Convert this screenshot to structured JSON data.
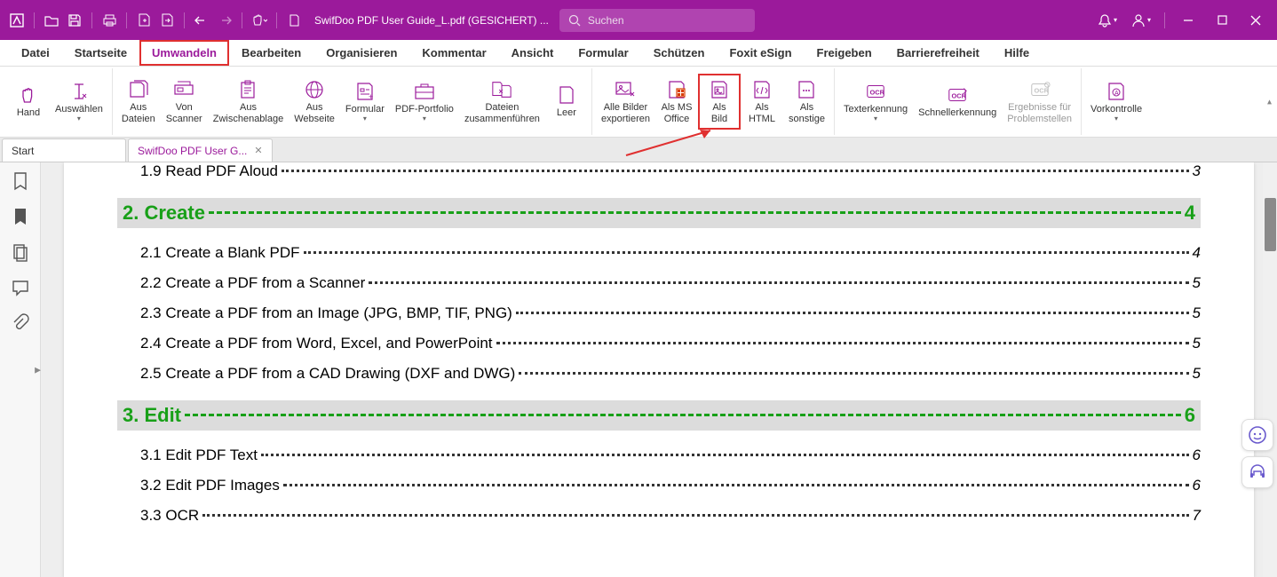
{
  "titlebar": {
    "filename": "SwifDoo PDF User Guide_L.pdf (GESICHERT) ...",
    "search_placeholder": "Suchen"
  },
  "menu": {
    "items": [
      "Datei",
      "Startseite",
      "Umwandeln",
      "Bearbeiten",
      "Organisieren",
      "Kommentar",
      "Ansicht",
      "Formular",
      "Schützen",
      "Foxit eSign",
      "Freigeben",
      "Barrierefreiheit",
      "Hilfe"
    ],
    "active_index": 2
  },
  "ribbon": {
    "hand": "Hand",
    "select": "Auswählen",
    "from_files": "Aus\nDateien",
    "from_scanner": "Von\nScanner",
    "from_clipboard": "Aus\nZwischenablage",
    "from_website": "Aus\nWebseite",
    "form": "Formular",
    "portfolio": "PDF-Portfolio",
    "merge": "Dateien\nzusammenführen",
    "blank": "Leer",
    "export_images": "Alle Bilder\nexportieren",
    "as_msoffice": "Als MS\nOffice",
    "as_image": "Als\nBild",
    "as_html": "Als\nHTML",
    "as_other": "Als\nsonstige",
    "ocr": "Texterkennung",
    "quick_ocr": "Schnellerkennung",
    "ocr_results": "Ergebnisse für\nProblemstellen",
    "preflight": "Vorkontrolle"
  },
  "tabs": {
    "start": "Start",
    "doc": "SwifDoo PDF User G..."
  },
  "toc": [
    {
      "type": "sub",
      "title": "1.9 Read PDF Aloud",
      "page": "3"
    },
    {
      "type": "section",
      "title": "2. Create",
      "page": "4"
    },
    {
      "type": "sub",
      "title": "2.1 Create a Blank PDF",
      "page": "4"
    },
    {
      "type": "sub",
      "title": "2.2 Create a PDF from a Scanner",
      "page": "5"
    },
    {
      "type": "sub",
      "title": "2.3 Create a PDF from an Image (JPG, BMP, TIF, PNG)",
      "page": "5"
    },
    {
      "type": "sub",
      "title": "2.4 Create a PDF from Word, Excel, and PowerPoint",
      "page": "5"
    },
    {
      "type": "sub",
      "title": "2.5 Create a PDF from a CAD Drawing (DXF and DWG)",
      "page": "5"
    },
    {
      "type": "section",
      "title": "3. Edit",
      "page": "6"
    },
    {
      "type": "sub",
      "title": "3.1 Edit PDF Text",
      "page": "6"
    },
    {
      "type": "sub",
      "title": "3.2 Edit PDF Images",
      "page": "6"
    },
    {
      "type": "sub",
      "title": "3.3 OCR",
      "page": "7"
    }
  ]
}
